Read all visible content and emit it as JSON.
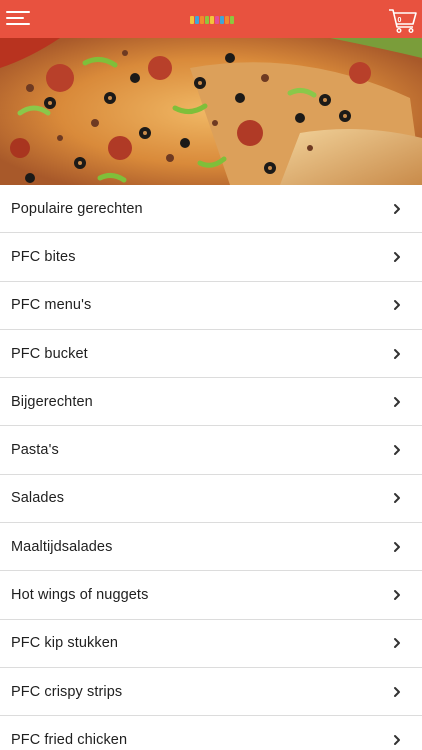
{
  "header": {
    "menu_icon": "hamburger-menu-icon",
    "logo": "colorful-logo",
    "cart_icon": "shopping-cart-icon",
    "cart_count": "0",
    "background_color": "#e8523f"
  },
  "hero": {
    "image": "pizza-banner"
  },
  "categories": [
    {
      "label": "Populaire gerechten"
    },
    {
      "label": "PFC bites"
    },
    {
      "label": "PFC menu's"
    },
    {
      "label": "PFC bucket"
    },
    {
      "label": "Bijgerechten"
    },
    {
      "label": "Pasta's"
    },
    {
      "label": "Salades"
    },
    {
      "label": "Maaltijdsalades"
    },
    {
      "label": "Hot wings of nuggets"
    },
    {
      "label": "PFC kip stukken"
    },
    {
      "label": "PFC crispy strips"
    },
    {
      "label": "PFC fried chicken"
    }
  ],
  "icons": {
    "chevron": "chevron-right-icon"
  }
}
